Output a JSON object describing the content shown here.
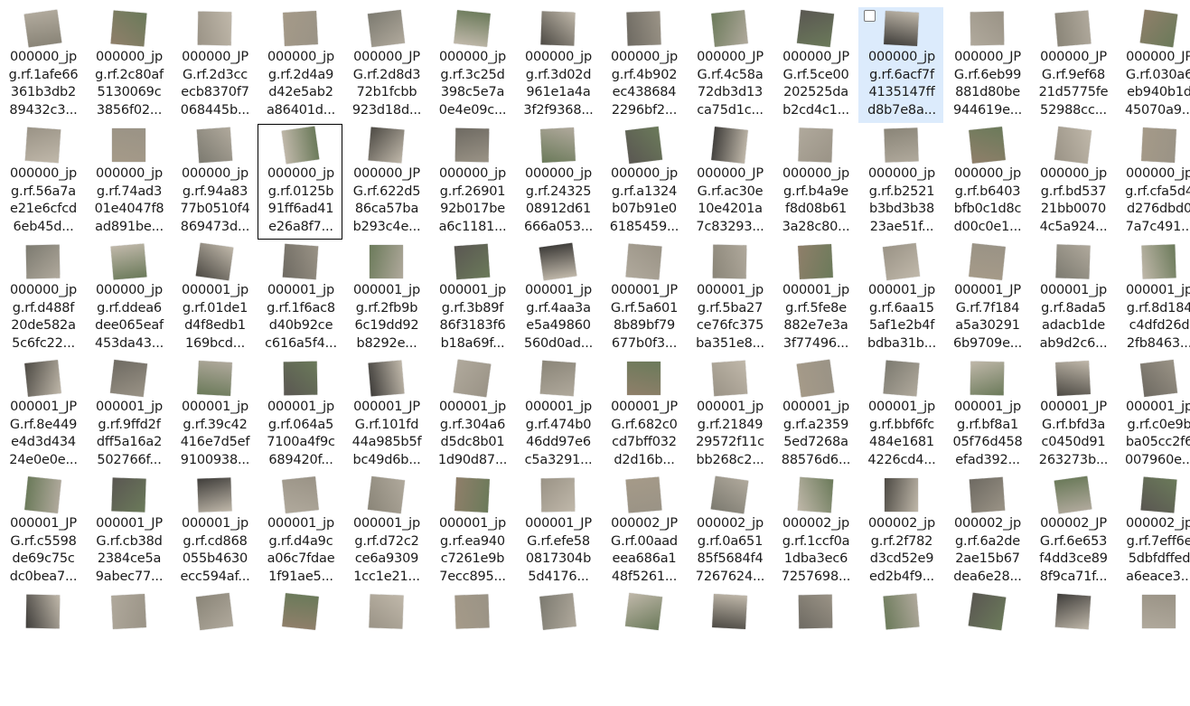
{
  "files": [
    {
      "name": "000000_jp\ng.rf.1afe66\n361b3db2\n89432c3..."
    },
    {
      "name": "000000_jp\ng.rf.2c80af\n5130069c\n3856f02..."
    },
    {
      "name": "000000_JP\nG.rf.2d3cc\necb8370f7\n068445b..."
    },
    {
      "name": "000000_jp\ng.rf.2d4a9\nd42e5ab2\na86401d..."
    },
    {
      "name": "000000_JP\nG.rf.2d8d3\n72b1fcbb\n923d18d..."
    },
    {
      "name": "000000_jp\ng.rf.3c25d\n398c5e7a\n0e4e09c..."
    },
    {
      "name": "000000_jp\ng.rf.3d02d\n961e1a4a\n3f2f9368..."
    },
    {
      "name": "000000_jp\ng.rf.4b902\nec438684\n2296bf2..."
    },
    {
      "name": "000000_JP\nG.rf.4c58a\n72db3d13\nca75d1c..."
    },
    {
      "name": "000000_JP\nG.rf.5ce00\n202525da\nb2cd4c1..."
    },
    {
      "name": "000000_jp\ng.rf.6acf7f\n4135147ff\nd8b7e8a...",
      "selected": true
    },
    {
      "name": "000000_JP\nG.rf.6eb99\n881d80be\n944619e..."
    },
    {
      "name": "000000_JP\nG.rf.9ef68\n21d5775fe\n52988cc..."
    },
    {
      "name": "000000_JP\nG.rf.030a6\neb940b1d\n45070a9..."
    },
    {
      "name": "000000_jp\ng.rf.56a7a\ne21e6cfcd\n6eb45d..."
    },
    {
      "name": "000000_jp\ng.rf.74ad3\n01e4047f8\nad891be..."
    },
    {
      "name": "000000_jp\ng.rf.94a83\n77b0510f4\n869473d..."
    },
    {
      "name": "000000_jp\ng.rf.0125b\n91ff6ad41\ne26a8f7...",
      "focused": true
    },
    {
      "name": "000000_JP\nG.rf.622d5\n86ca57ba\nb293c4e..."
    },
    {
      "name": "000000_jp\ng.rf.26901\n92b017be\na6c1181..."
    },
    {
      "name": "000000_jp\ng.rf.24325\n08912d61\n666a053..."
    },
    {
      "name": "000000_jp\ng.rf.a1324\nb07b91e0\n6185459..."
    },
    {
      "name": "000000_JP\nG.rf.ac30e\n10e4201a\n7c83293..."
    },
    {
      "name": "000000_jp\ng.rf.b4a9e\nf8d08b61\n3a28c80..."
    },
    {
      "name": "000000_jp\ng.rf.b2521\nb3bd3b38\n23ae51f..."
    },
    {
      "name": "000000_jp\ng.rf.b6403\nbfb0c1d8c\nd00c0e1..."
    },
    {
      "name": "000000_jp\ng.rf.bd537\n21bb0070\n4c5a924..."
    },
    {
      "name": "000000_jp\ng.rf.cfa5d4\nd276dbd0\n7a7c491..."
    },
    {
      "name": "000000_jp\ng.rf.d488f\n20de582a\n5c6fc22..."
    },
    {
      "name": "000000_jp\ng.rf.ddea6\ndee065eaf\n453da43..."
    },
    {
      "name": "000001_jp\ng.rf.01de1\nd4f8edb1\n169bcd..."
    },
    {
      "name": "000001_jp\ng.rf.1f6ac8\nd40b92ce\nc616a5f4..."
    },
    {
      "name": "000001_jp\ng.rf.2fb9b\n6c19dd92\nb8292e..."
    },
    {
      "name": "000001_jp\ng.rf.3b89f\n86f3183f6\nb18a69f..."
    },
    {
      "name": "000001_jp\ng.rf.4aa3a\ne5a49860\n560d0ad..."
    },
    {
      "name": "000001_JP\nG.rf.5a601\n8b89bf79\n677b0f3..."
    },
    {
      "name": "000001_jp\ng.rf.5ba27\nce76fc375\nba351e8..."
    },
    {
      "name": "000001_jp\ng.rf.5fe8e\n882e7e3a\n3f77496..."
    },
    {
      "name": "000001_jp\ng.rf.6aa15\n5af1e2b4f\nbdba31b..."
    },
    {
      "name": "000001_JP\nG.rf.7f184\na5a30291\n6b9709e..."
    },
    {
      "name": "000001_jp\ng.rf.8ada5\nadacb1de\nab9d2c6..."
    },
    {
      "name": "000001_jp\ng.rf.8d184\nc4dfd26d\n2fb8463..."
    },
    {
      "name": "000001_JP\nG.rf.8e449\ne4d3d434\n24e0e0e..."
    },
    {
      "name": "000001_jp\ng.rf.9ffd2f\ndff5a16a2\n502766f..."
    },
    {
      "name": "000001_jp\ng.rf.39c42\n416e7d5ef\n9100938..."
    },
    {
      "name": "000001_jp\ng.rf.064a5\n7100a4f9c\n689420f..."
    },
    {
      "name": "000001_JP\nG.rf.101fd\n44a985b5f\nbc49d6b..."
    },
    {
      "name": "000001_jp\ng.rf.304a6\nd5dc8b01\n1d90d87..."
    },
    {
      "name": "000001_jp\ng.rf.474b0\n46dd97e6\nc5a3291..."
    },
    {
      "name": "000001_JP\nG.rf.682c0\ncd7bff032\nd2d16b..."
    },
    {
      "name": "000001_jp\ng.rf.21849\n29572f11c\nbb268c2..."
    },
    {
      "name": "000001_jp\ng.rf.a2359\n5ed7268a\n88576d6..."
    },
    {
      "name": "000001_jp\ng.rf.bbf6fc\n484e1681\n4226cd4..."
    },
    {
      "name": "000001_jp\ng.rf.bf8a1\n05f76d458\nefad392..."
    },
    {
      "name": "000001_JP\nG.rf.bfd3a\nc0450d91\n263273b..."
    },
    {
      "name": "000001_jp\ng.rf.c0e9b\nba05cc2f6\n007960e..."
    },
    {
      "name": "000001_JP\nG.rf.c5598\nde69c75c\ndc0bea7..."
    },
    {
      "name": "000001_JP\nG.rf.cb38d\n2384ce5a\n9abec77..."
    },
    {
      "name": "000001_jp\ng.rf.cd868\n055b4630\necc594af..."
    },
    {
      "name": "000001_jp\ng.rf.d4a9c\na06c7fdae\n1f91ae5..."
    },
    {
      "name": "000001_jp\ng.rf.d72c2\nce6a9309\n1cc1e21..."
    },
    {
      "name": "000001_jp\ng.rf.ea940\nc7261e9b\n7ecc895..."
    },
    {
      "name": "000001_JP\nG.rf.efe58\n0817304b\n5d4176..."
    },
    {
      "name": "000002_JP\nG.rf.00aad\neea686a1\n48f5261..."
    },
    {
      "name": "000002_jp\ng.rf.0a651\n85f5684f4\n7267624..."
    },
    {
      "name": "000002_jp\ng.rf.1ccf0a\n1dba3ec6\n7257698..."
    },
    {
      "name": "000002_jp\ng.rf.2f782\nd3cd52e9\ned2b4f9..."
    },
    {
      "name": "000002_jp\ng.rf.6a2de\n2ae15b67\ndea6e28..."
    },
    {
      "name": "000002_JP\nG.rf.6e653\nf4dd3ce89\n8f9ca71f..."
    },
    {
      "name": "000002_jp\ng.rf.7eff6e\n5dbfdffed\na6eace3..."
    },
    {
      "name": ""
    },
    {
      "name": ""
    },
    {
      "name": ""
    },
    {
      "name": ""
    },
    {
      "name": ""
    },
    {
      "name": ""
    },
    {
      "name": ""
    },
    {
      "name": ""
    },
    {
      "name": ""
    },
    {
      "name": ""
    },
    {
      "name": ""
    },
    {
      "name": ""
    },
    {
      "name": ""
    },
    {
      "name": ""
    }
  ],
  "thumbnail_palette": [
    "#8a8578",
    "#6e6a62",
    "#9a9386",
    "#5a5752",
    "#7c7a70",
    "#b0a99c",
    "#4d4a44",
    "#8f7f6a",
    "#6b7a5a",
    "#a59a88",
    "#3f3d3a",
    "#c0b8aa"
  ],
  "selection_color": "#dcebfc",
  "focus_border_color": "#000000"
}
